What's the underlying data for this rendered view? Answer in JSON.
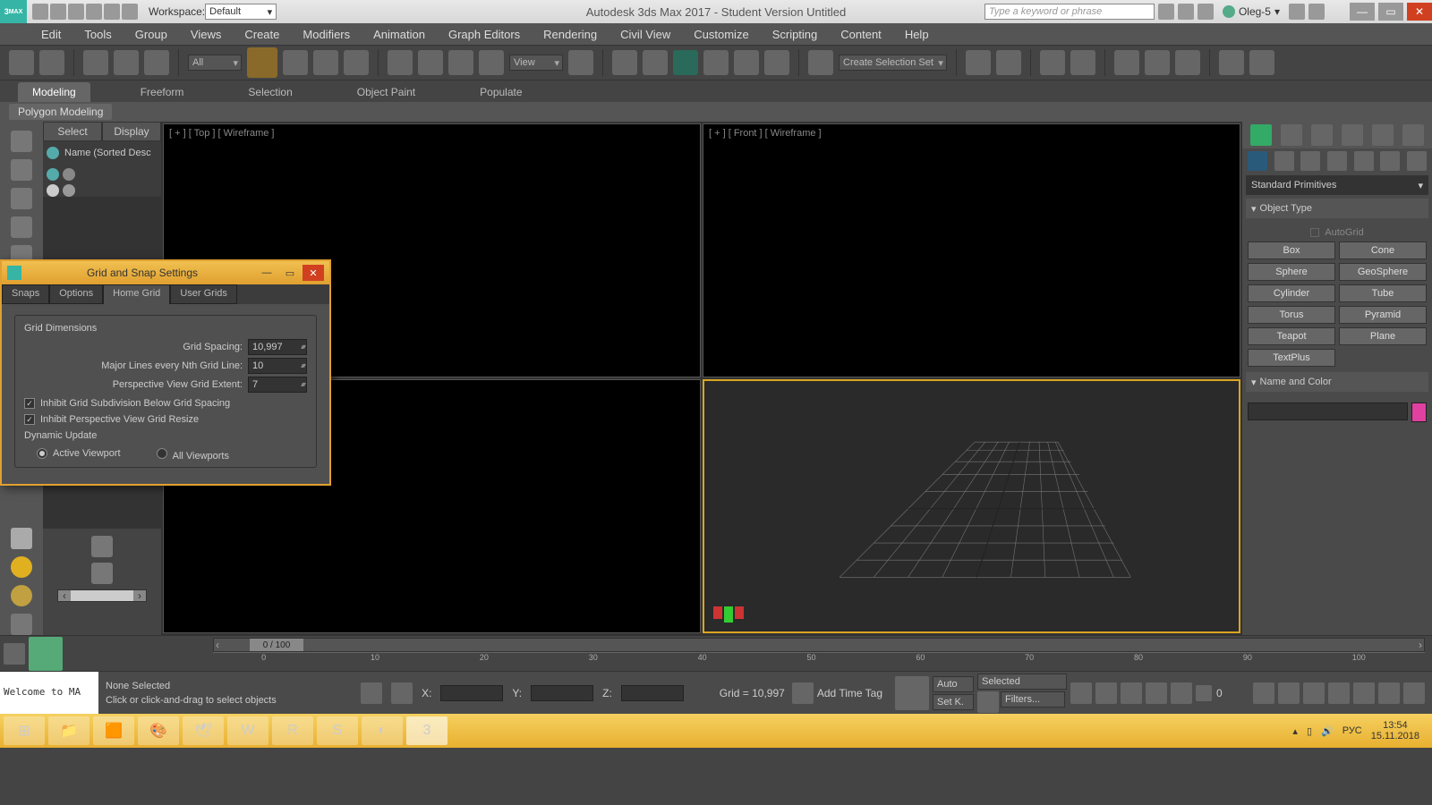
{
  "titlebar": {
    "workspace_label": "Workspace:",
    "workspace_value": "Default",
    "app_title": "Autodesk 3ds Max 2017 - Student Version    Untitled",
    "search_placeholder": "Type a keyword or phrase",
    "user": "Oleg-5"
  },
  "menu": [
    "Edit",
    "Tools",
    "Group",
    "Views",
    "Create",
    "Modifiers",
    "Animation",
    "Graph Editors",
    "Rendering",
    "Civil View",
    "Customize",
    "Scripting",
    "Content",
    "Help"
  ],
  "toolbar": {
    "filter_all": "All",
    "view": "View",
    "sel_set": "Create Selection Set"
  },
  "ribbon": {
    "tabs": [
      "Modeling",
      "Freeform",
      "Selection",
      "Object Paint",
      "Populate"
    ],
    "sub": "Polygon Modeling"
  },
  "scene": {
    "tabs": [
      "Select",
      "Display"
    ],
    "header": "Name (Sorted Desc"
  },
  "viewports": {
    "tl": "[ + ]  [ Top ]  [ Wireframe ]",
    "tr": "[ + ]  [ Front ]  [ Wireframe ]",
    "bl": "",
    "br": ""
  },
  "cmdpanel": {
    "category": "Standard Primitives",
    "rollout_obj": "Object Type",
    "autogrid": "AutoGrid",
    "prims": [
      "Box",
      "Cone",
      "Sphere",
      "GeoSphere",
      "Cylinder",
      "Tube",
      "Torus",
      "Pyramid",
      "Teapot",
      "Plane",
      "TextPlus"
    ],
    "rollout_name": "Name and Color"
  },
  "timeslider": {
    "pos": "0 / 100",
    "ticks": [
      "0",
      "10",
      "20",
      "30",
      "40",
      "50",
      "60",
      "70",
      "80",
      "90",
      "100"
    ]
  },
  "status": {
    "welcome": "Welcome to MA",
    "sel": "None Selected",
    "hint": "Click or click-and-drag to select objects",
    "x": "X:",
    "y": "Y:",
    "z": "Z:",
    "grid": "Grid = 10,997",
    "addtag": "Add Time Tag",
    "auto": "Auto",
    "setk": "Set K.",
    "selected": "Selected",
    "filters": "Filters...",
    "zero": "0"
  },
  "dialog": {
    "title": "Grid and Snap Settings",
    "tabs": [
      "Snaps",
      "Options",
      "Home Grid",
      "User Grids"
    ],
    "grp_dim": "Grid Dimensions",
    "grid_spacing_label": "Grid Spacing:",
    "grid_spacing_val": "10,997",
    "major_label": "Major Lines every Nth Grid Line:",
    "major_val": "10",
    "extent_label": "Perspective View Grid Extent:",
    "extent_val": "7",
    "chk1": "Inhibit Grid Subdivision Below Grid Spacing",
    "chk2": "Inhibit Perspective View Grid Resize",
    "grp_dyn": "Dynamic Update",
    "radio1": "Active Viewport",
    "radio2": "All Viewports"
  },
  "taskbar": {
    "lang": "РУС",
    "time": "13:54",
    "date": "15.11.2018"
  }
}
